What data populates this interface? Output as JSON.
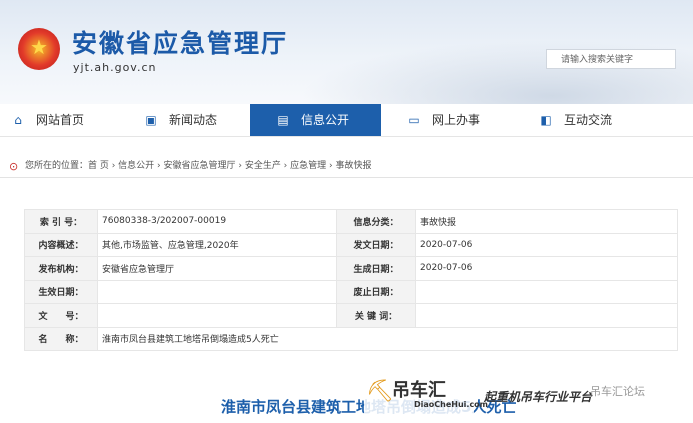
{
  "header": {
    "title": "安徽省应急管理厅",
    "url": "yjt.ah.gov.cn",
    "search_placeholder": "请输入搜索关键字"
  },
  "nav": [
    {
      "label": "网站首页",
      "icon": "home-icon"
    },
    {
      "label": "新闻动态",
      "icon": "news-icon"
    },
    {
      "label": "信息公开",
      "icon": "document-icon",
      "active": true
    },
    {
      "label": "网上办事",
      "icon": "monitor-icon"
    },
    {
      "label": "互动交流",
      "icon": "chat-icon"
    }
  ],
  "breadcrumb": "您所在的位置：首 页 › 信息公开 › 安徽省应急管理厅 › 安全生产 › 应急管理 › 事故快报",
  "info": {
    "index_label": "索 引 号：",
    "index_value": "76080338-3/202007-00019",
    "category_label": "信息分类：",
    "category_value": "事故快报",
    "summary_label": "内容概述：",
    "summary_value": "其他,市场监管、应急管理,2020年",
    "pubdate_label": "发文日期：",
    "pubdate_value": "2020-07-06",
    "issuer_label": "发布机构：",
    "issuer_value": "安徽省应急管理厅",
    "gendate_label": "生成日期：",
    "gendate_value": "2020-07-06",
    "effective_label": "生效日期：",
    "effective_value": "",
    "expire_label": "废止日期：",
    "expire_value": "",
    "docno_label": "文　　号：",
    "docno_value": "",
    "keyword_label": "关 键 词：",
    "keyword_value": "",
    "name_label": "名　　称：",
    "name_value": "淮南市凤台县建筑工地塔吊倒塌造成5人死亡"
  },
  "article_title": "淮南市凤台县建筑工地塔吊倒塌造成5人死亡",
  "watermark": {
    "brand": "吊车汇",
    "domain": "DiaoCheHui.com",
    "slogan": "起重机吊车行业平台",
    "forum": "吊车汇论坛"
  }
}
